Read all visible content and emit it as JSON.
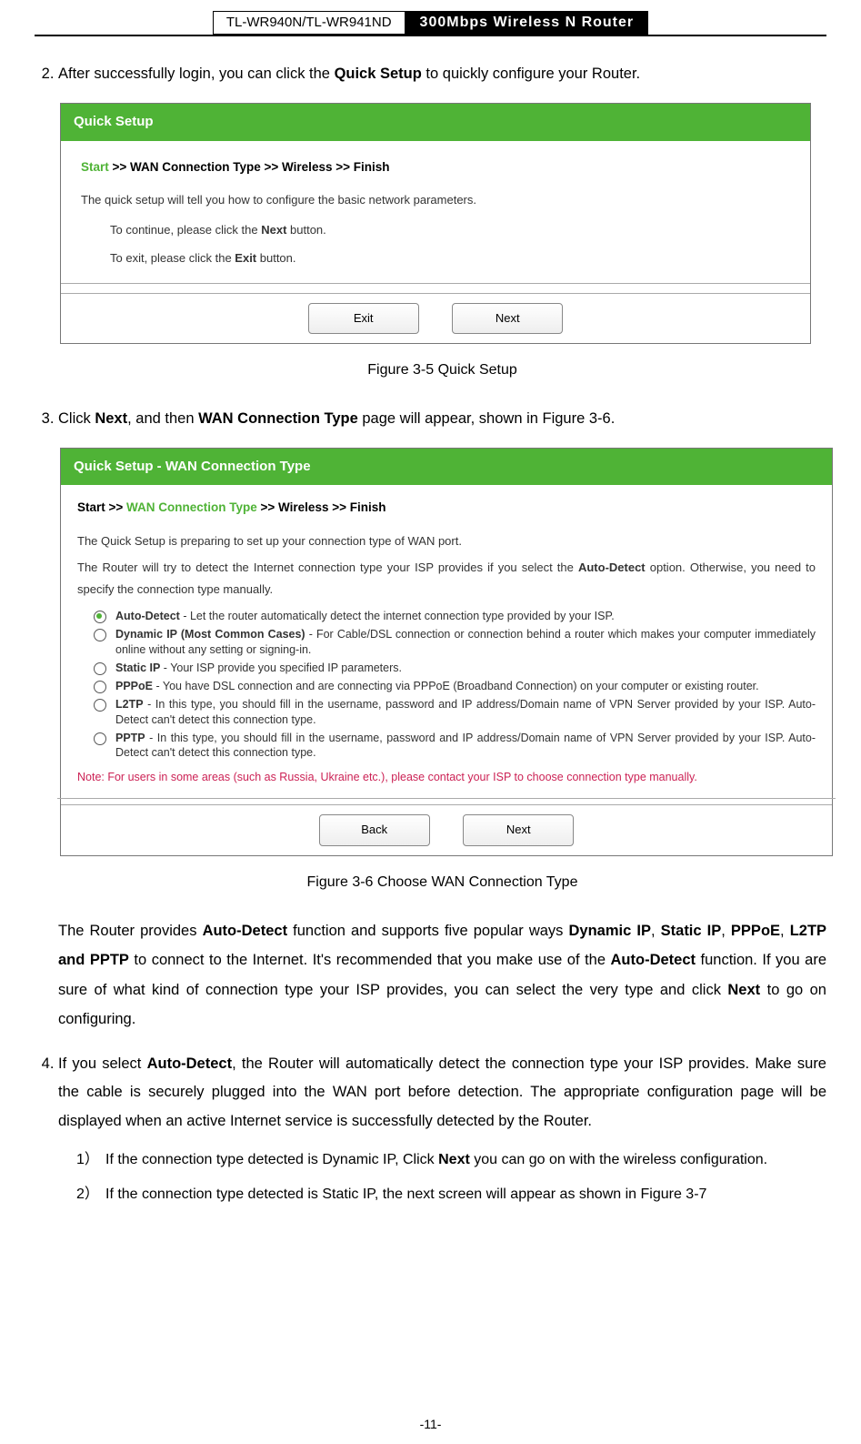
{
  "header": {
    "model": "TL-WR940N/TL-WR941ND",
    "product": "300Mbps Wireless N Router"
  },
  "step2": {
    "text_a": "After successfully login, you can click the ",
    "bold": "Quick Setup",
    "text_b": " to quickly configure your Router."
  },
  "fig35": {
    "title": "Quick Setup",
    "crumb_start": "Start",
    "crumb_rest": " >> WAN Connection Type >> Wireless >> Finish",
    "line1": "The quick setup will tell you how to configure the basic network parameters.",
    "line2a": "To continue, please click the ",
    "line2b": "Next",
    "line2c": " button.",
    "line3a": "To exit, please click the ",
    "line3b": "Exit",
    "line3c": "  button.",
    "btn_exit": "Exit",
    "btn_next": "Next",
    "caption": "Figure 3-5    Quick Setup"
  },
  "step3": {
    "a": "Click ",
    "b": "Next",
    "c": ", and then ",
    "d": "WAN Connection Type",
    "e": " page will appear, shown in Figure 3-6."
  },
  "fig36": {
    "title": "Quick Setup - WAN Connection Type",
    "crumb_start": "Start >> ",
    "crumb_active": "WAN Connection Type",
    "crumb_rest": " >> Wireless >> Finish",
    "p1": "The Quick Setup is preparing to set up your connection type of WAN port.",
    "p2a": "The Router will try to detect the Internet connection type your ISP provides if you select the ",
    "p2b": "Auto-Detect",
    "p2c": " option. Otherwise, you need to specify the connection type manually.",
    "opt1_b": "Auto-Detect",
    "opt1_t": " - Let the router automatically detect the internet connection type provided by your ISP.",
    "opt2_b": "Dynamic IP (Most Common Cases)",
    "opt2_t": " - For Cable/DSL connection or connection behind a router which makes your computer immediately online without any setting or signing-in.",
    "opt3_b": "Static IP",
    "opt3_t": " - Your ISP provide you specified IP parameters.",
    "opt4_b": "PPPoE",
    "opt4_t": " - You have DSL connection and are connecting via PPPoE (Broadband Connection) on your computer or existing router.",
    "opt5_b": "L2TP",
    "opt5_t": " - In this type, you should fill in the username, password and IP address/Domain name of VPN Server provided by your ISP. Auto-Detect can't detect this connection type.",
    "opt6_b": "PPTP",
    "opt6_t": " - In this type, you should fill in the username, password and IP address/Domain name of VPN Server provided by your ISP. Auto-Detect can't detect this connection type.",
    "note": "Note: For users in some areas (such as Russia, Ukraine etc.), please contact your ISP to choose connection type manually.",
    "btn_back": "Back",
    "btn_next": "Next",
    "caption": "Figure 3-6    Choose WAN Connection Type"
  },
  "para_after": {
    "t1": "The Router provides ",
    "b1": "Auto-Detect",
    "t2": " function and supports five popular ways ",
    "b2": "Dynamic IP",
    "t3": ", ",
    "b3": "Static IP",
    "t4": ", ",
    "b4": "PPPoE",
    "t5": ", ",
    "b5": "L2TP and PPTP",
    "t6": " to connect to the Internet. It's recommended that you make use of the ",
    "b6": "Auto-Detect",
    "t7": " function. If you are sure of what kind of connection type your ISP provides, you can select the very type and click ",
    "b7": "Next",
    "t8": " to go on configuring."
  },
  "step4": {
    "a": "If you select ",
    "b": "Auto-Detect",
    "c": ", the Router will automatically detect the connection type your ISP provides. Make sure the cable is securely plugged into the WAN port before detection. The appropriate configuration page will be displayed when an active Internet service is successfully detected by the Router."
  },
  "inner": {
    "n1": "1）",
    "i1a": "If the connection type detected is Dynamic IP, Click ",
    "i1b": "Next",
    "i1c": " you can go on with the wireless configuration.",
    "n2": "2）",
    "i2": "If the connection type detected is Static IP, the next screen will appear as shown in Figure 3-7"
  },
  "page_num": "-11-"
}
